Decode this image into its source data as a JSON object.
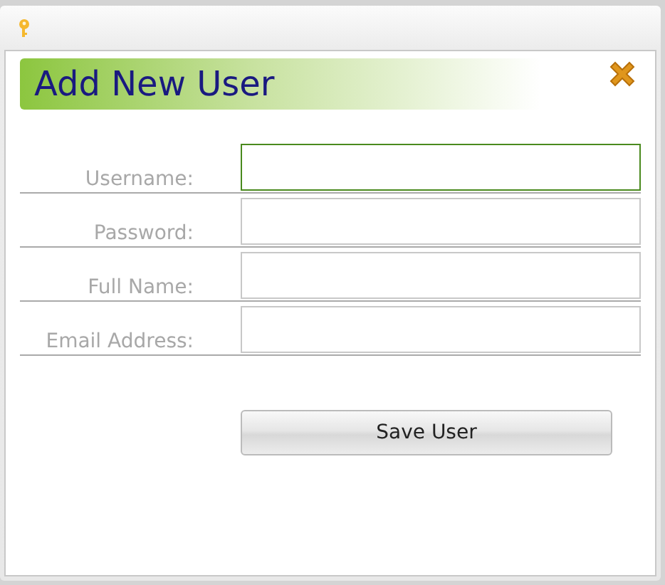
{
  "dialog": {
    "title": "Add New User"
  },
  "fields": [
    {
      "label": "Username:",
      "focused": true
    },
    {
      "label": "Password:",
      "focused": false
    },
    {
      "label": "Full Name:",
      "focused": false
    },
    {
      "label": "Email Address:",
      "focused": false
    }
  ],
  "save_button": {
    "label": "Save User"
  }
}
